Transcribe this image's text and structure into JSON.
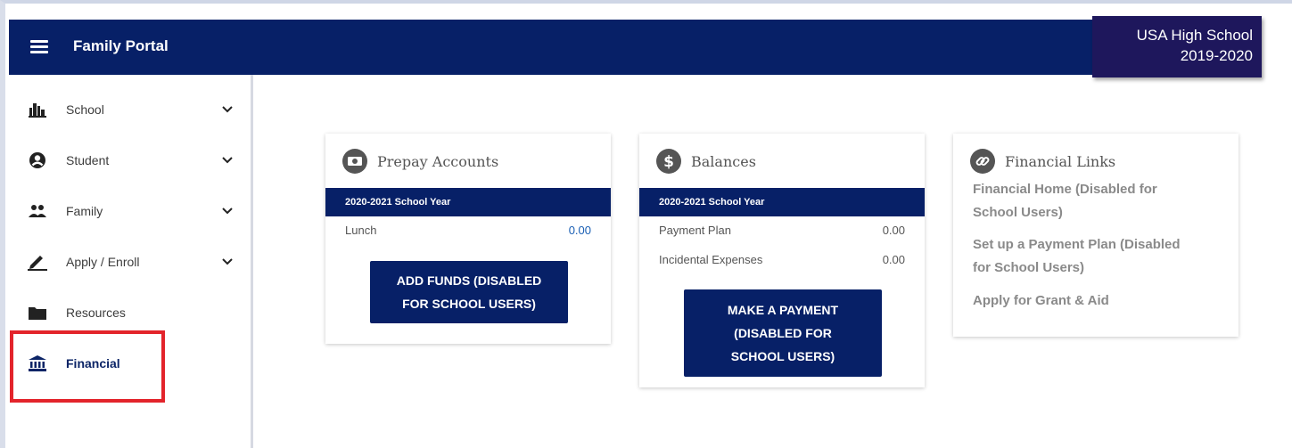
{
  "header": {
    "title": "Family Portal",
    "school_name": "USA High School",
    "school_year": "2019-2020"
  },
  "sidebar": {
    "items": [
      {
        "label": "School",
        "icon": "building-icon"
      },
      {
        "label": "Student",
        "icon": "user-circle-icon"
      },
      {
        "label": "Family",
        "icon": "family-icon"
      },
      {
        "label": "Apply / Enroll",
        "icon": "pencil-icon"
      },
      {
        "label": "Resources",
        "icon": "folder-icon"
      },
      {
        "label": "Financial",
        "icon": "bank-icon"
      }
    ]
  },
  "prepay": {
    "title": "Prepay Accounts",
    "year": "2020-2021 School Year",
    "row_label": "Lunch",
    "row_value": "0.00",
    "button_line1": "ADD FUNDS (DISABLED",
    "button_line2": "FOR SCHOOL USERS)"
  },
  "balances": {
    "title": "Balances",
    "year": "2020-2021 School Year",
    "rows": [
      {
        "label": "Payment Plan",
        "value": "0.00"
      },
      {
        "label": "Incidental Expenses",
        "value": "0.00"
      }
    ],
    "button_line1": "MAKE A PAYMENT",
    "button_line2": "(DISABLED FOR",
    "button_line3": "SCHOOL USERS)"
  },
  "links": {
    "title": "Financial Links",
    "items": [
      {
        "line1": "Financial Home (Disabled for",
        "line2": "School Users)"
      },
      {
        "line1": "Set up a Payment Plan (Disabled",
        "line2": "for School Users)"
      },
      {
        "line1": "Apply for Grant & Aid",
        "line2": ""
      }
    ]
  },
  "colors": {
    "navy": "#072067",
    "badge": "#1e175c",
    "highlight": "#e3242b"
  }
}
